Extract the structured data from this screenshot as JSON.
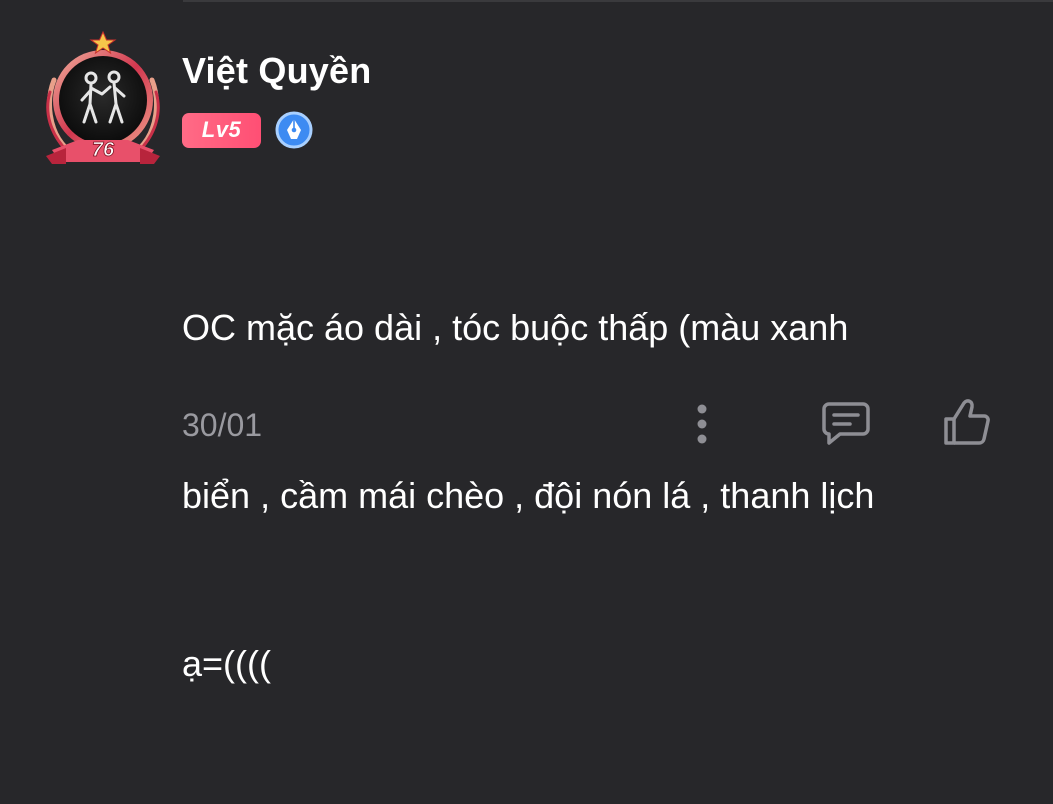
{
  "comment": {
    "username": "Việt Quyền",
    "level": "Lv5",
    "avatar_frame_number": "76",
    "text_lines": [
      "OC mặc áo dài , tóc buộc thấp (màu xanh",
      "biển , cầm mái chèo , đội nón lá , thanh lịch",
      "ạ=(((("
    ],
    "date": "30/01"
  },
  "icons": {
    "avatar": "avatar-couple-icon",
    "frame_star": "star-icon",
    "writer_badge": "pen-nib-icon",
    "more": "more-vertical-icon",
    "reply": "comment-icon",
    "like": "thumbs-up-icon"
  },
  "colors": {
    "background": "#27272a",
    "level_badge": "#ff5a7a",
    "writer_badge": "#3d8bf2",
    "muted_text": "#9a9aa0",
    "icon": "#8e8e94"
  }
}
